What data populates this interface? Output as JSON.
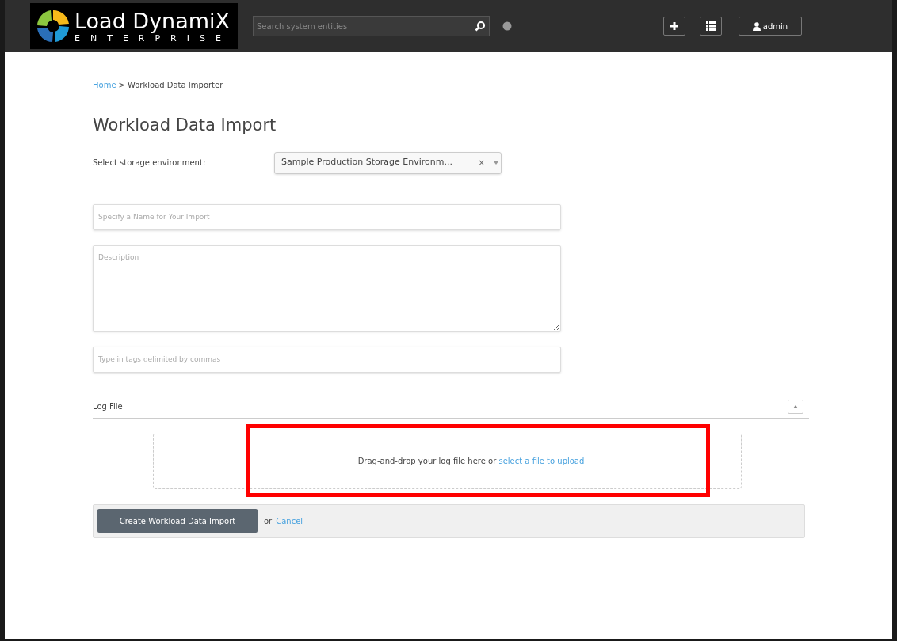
{
  "header": {
    "logo": {
      "name": "Load DynamiX",
      "subtitle": "ENTERPRISE"
    },
    "search": {
      "placeholder": "Search system entities"
    },
    "user_button": "admin"
  },
  "breadcrumb": {
    "link": "Home",
    "separator": ">",
    "current": "Workload Data Importer"
  },
  "title": "Workload Data Import",
  "storage_environment": {
    "label": "Select storage environment:",
    "value": "Sample Production Storage Environm...",
    "clear": "×"
  },
  "fields": [
    {
      "kind": "input",
      "placeholder": "Specify a Name for Your Import"
    },
    {
      "kind": "textarea",
      "placeholder": "Description"
    },
    {
      "kind": "input",
      "placeholder": "Type in tags delimited by commas"
    }
  ],
  "log_file": {
    "title": "Log File",
    "expanded": true,
    "dropzone_text": "Drag-and-drop your log file here or",
    "dropzone_link": "select a file to upload",
    "highlighted": true
  },
  "actions": {
    "submit": "Create Workload Data Import",
    "or": "or",
    "cancel": "Cancel"
  }
}
